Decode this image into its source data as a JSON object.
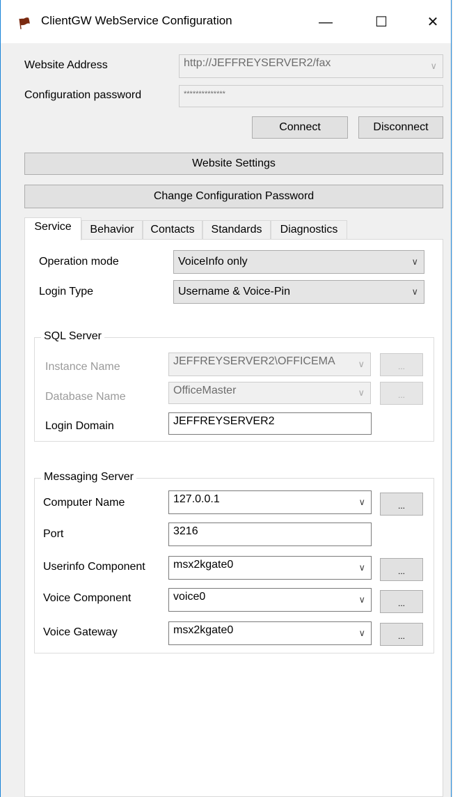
{
  "window": {
    "title": "ClientGW WebService Configuration",
    "app_icon": "app-logo-icon",
    "minimize_glyph": "—",
    "maximize_glyph": "☐",
    "close_glyph": "✕"
  },
  "connection": {
    "website_address_label": "Website Address",
    "website_address_value": "http://JEFFREYSERVER2/fax",
    "config_password_label": "Configuration password",
    "config_password_value": "**************",
    "connect_label": "Connect",
    "disconnect_label": "Disconnect"
  },
  "actions": {
    "website_settings_label": "Website Settings",
    "change_password_label": "Change Configuration Password"
  },
  "tabs": [
    {
      "label": "Service",
      "active": true
    },
    {
      "label": "Behavior",
      "active": false
    },
    {
      "label": "Contacts",
      "active": false
    },
    {
      "label": "Standards",
      "active": false
    },
    {
      "label": "Diagnostics",
      "active": false
    }
  ],
  "service": {
    "operation_mode_label": "Operation mode",
    "operation_mode_value": "VoiceInfo only",
    "login_type_label": "Login Type",
    "login_type_value": "Username & Voice-Pin",
    "sql_server": {
      "title": "SQL Server",
      "instance_name_label": "Instance Name",
      "instance_name_value": "JEFFREYSERVER2\\OFFICEMA",
      "database_name_label": "Database Name",
      "database_name_value": "OfficeMaster",
      "login_domain_label": "Login Domain",
      "login_domain_value": "JEFFREYSERVER2",
      "browse_label": "..."
    },
    "messaging_server": {
      "title": "Messaging Server",
      "computer_name_label": "Computer Name",
      "computer_name_value": "127.0.0.1",
      "port_label": "Port",
      "port_value": "3216",
      "userinfo_component_label": "Userinfo Component",
      "userinfo_component_value": "msx2kgate0",
      "voice_component_label": "Voice Component",
      "voice_component_value": "voice0",
      "voice_gateway_label": "Voice Gateway",
      "voice_gateway_value": "msx2kgate0",
      "browse_label": "..."
    }
  },
  "colors": {
    "window_border": "#1883d7",
    "background": "#f0f0f0",
    "panel": "#ffffff"
  }
}
